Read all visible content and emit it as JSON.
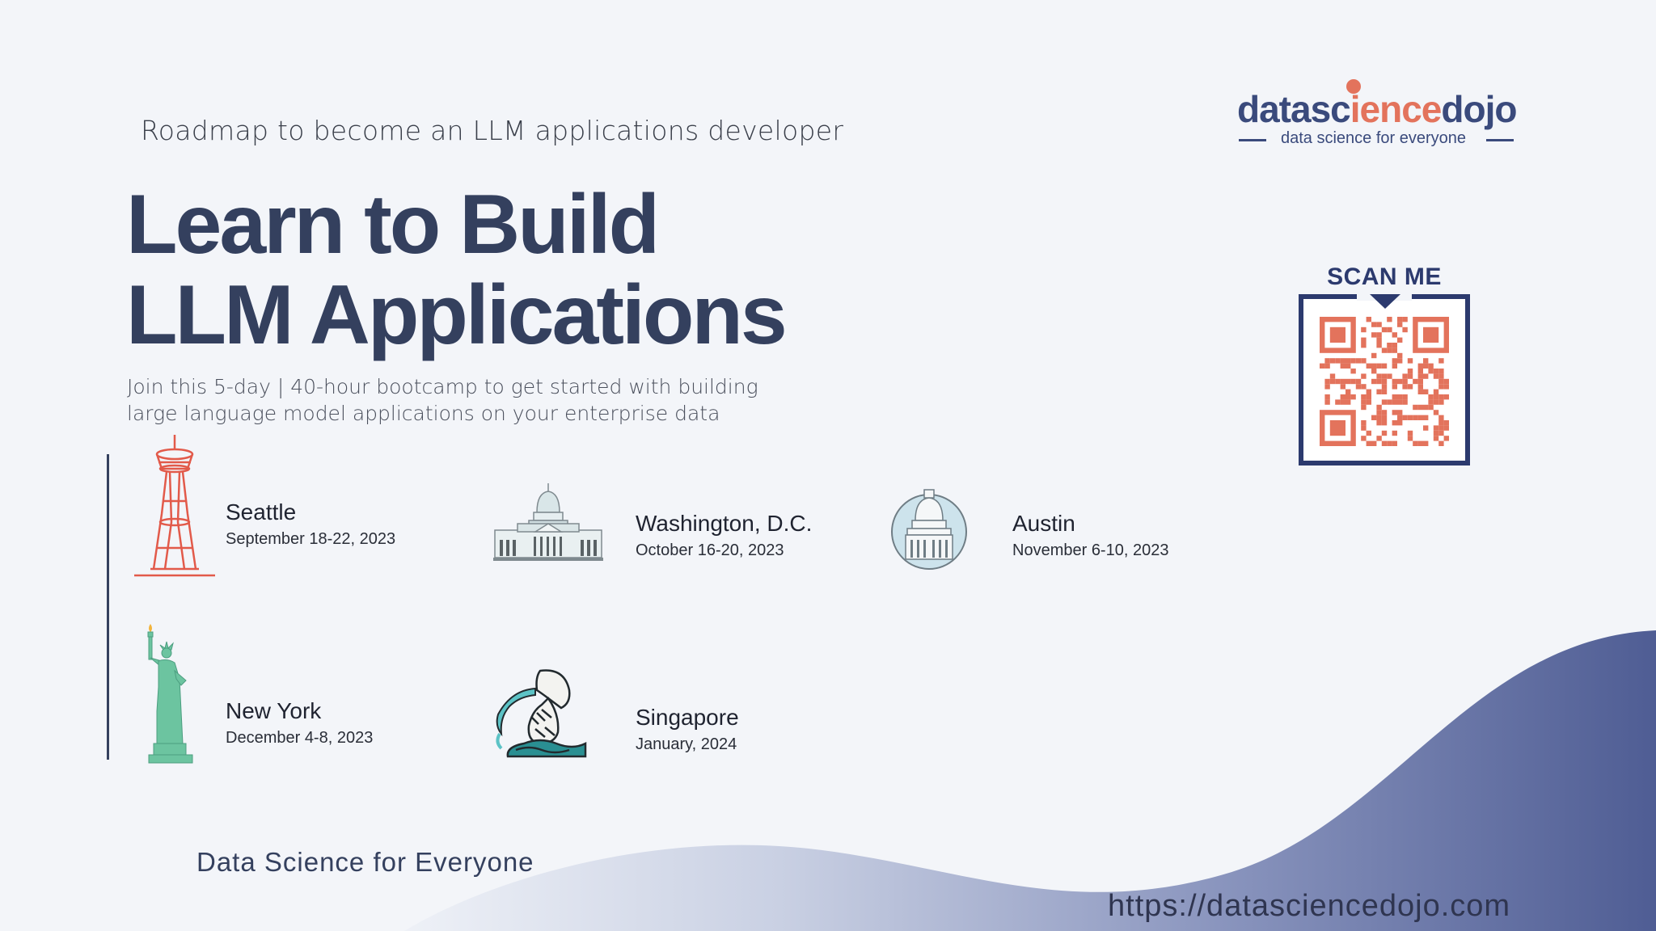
{
  "header": {
    "roadmap_label": "Roadmap to become an LLM applications developer"
  },
  "hero": {
    "title_line1": "Learn to Build",
    "title_line2": "LLM Applications",
    "subtitle_line1": "Join this 5-day | 40-hour bootcamp to get started with building",
    "subtitle_line2": "large language model applications on your enterprise data"
  },
  "logo": {
    "word_part1": "datasc",
    "word_part2": "ience",
    "word_part3": "dojo",
    "tagline": "data science for everyone"
  },
  "qr": {
    "label": "SCAN ME"
  },
  "locations": [
    {
      "city": "Seattle",
      "dates": "September 18-22, 2023",
      "icon": "space-needle-icon"
    },
    {
      "city": "Washington, D.C.",
      "dates": "October 16-20, 2023",
      "icon": "capitol-building-icon"
    },
    {
      "city": "Austin",
      "dates": "November 6-10, 2023",
      "icon": "texas-capitol-icon"
    },
    {
      "city": "New York",
      "dates": "December 4-8, 2023",
      "icon": "statue-of-liberty-icon"
    },
    {
      "city": "Singapore",
      "dates": "January, 2024",
      "icon": "merlion-icon"
    }
  ],
  "footer": {
    "tagline": "Data Science for Everyone",
    "website": "https://datasciencedojo.com"
  },
  "colors": {
    "navy": "#34405e",
    "brand_orange": "#e3735c",
    "wave_dark": "#4e5c93",
    "wave_light": "#c8d0e2",
    "background": "#f3f5f9"
  }
}
